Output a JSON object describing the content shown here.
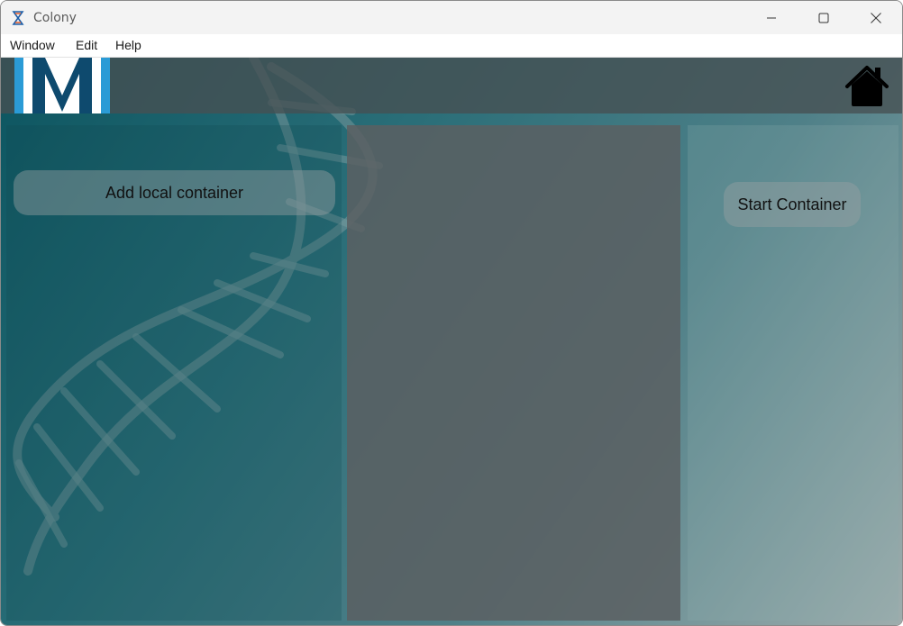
{
  "window": {
    "title": "Colony",
    "app_icon": "dna-hourglass-icon",
    "controls": [
      "minimize-icon",
      "maximize-icon",
      "close-icon"
    ]
  },
  "menu": {
    "items": [
      {
        "label": "Window"
      },
      {
        "label": "Edit"
      },
      {
        "label": "Help"
      }
    ]
  },
  "header": {
    "logo_icon": "logo-icon",
    "home_icon": "home-icon"
  },
  "left_panel": {
    "add_button_label": "Add local container"
  },
  "right_panel": {
    "start_button_label": "Start Container"
  },
  "colors": {
    "logo_blue": "#2b9bd6",
    "logo_dark": "#0e4a6e",
    "background_teal": "#0c5560",
    "middle_panel": "#5a5f62"
  }
}
